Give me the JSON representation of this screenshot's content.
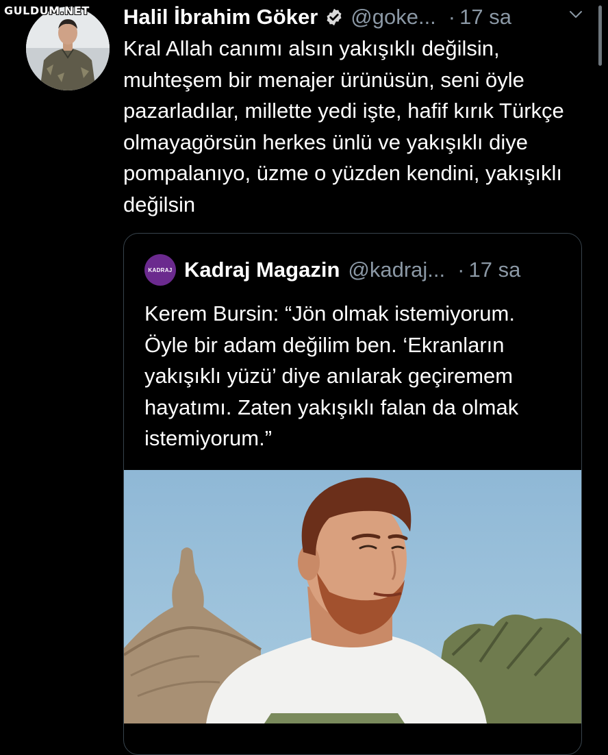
{
  "watermark": "GULDUM.NET",
  "tweet": {
    "author_name": "Halil İbrahim Göker",
    "handle": "@goke...",
    "separator": "·",
    "time": "17 sa",
    "text": "Kral Allah canımı alsın yakışıklı değilsin, muhteşem bir menajer ürünüsün, seni öyle pazarladılar, millette yedi işte, hafif kırık Türkçe olmayagörsün herkes ünlü ve yakışıklı diye pompalanıyo, üzme o yüzden kendini, yakışıklı değilsin",
    "icons": {
      "verified": "verified-badge-icon",
      "menu": "chevron-down-icon"
    }
  },
  "quoted": {
    "logo_text": "KADRAJ",
    "author_name": "Kadraj Magazin",
    "handle": "@kadraj...",
    "separator": "·",
    "time": "17 sa",
    "text": "Kerem Bursin: “Jön olmak istemiyorum. Öyle bir adam değilim ben. ‘Ekranların yakışıklı yüzü’ diye anılarak geçiremem hayatımı. Zaten yakışıklı falan da olmak istemiyorum.”"
  },
  "colors": {
    "background": "#000000",
    "text": "#ffffff",
    "secondary": "#8b98a5",
    "border": "#38444d",
    "brand_purple": "#6b2a8e"
  }
}
